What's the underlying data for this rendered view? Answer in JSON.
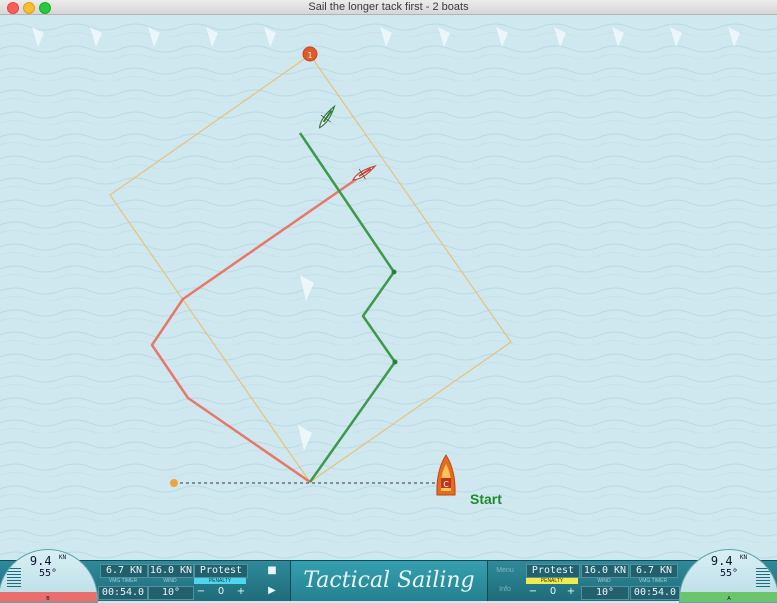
{
  "window": {
    "title": "Sail the longer tack first - 2 boats"
  },
  "course": {
    "mark_label": "1",
    "committee_boat_label": "C",
    "start_label": "Start"
  },
  "colors": {
    "red_boat": "#e8776a",
    "green_boat": "#3c9a4a",
    "laylines": "#e6c27a",
    "sea": "#cfe8f0"
  },
  "left_panel": {
    "speed": "9.4",
    "speed_unit": "KN",
    "heading": "55°",
    "gauge_label": "B",
    "vmg_value": "6.7 KN",
    "vmg_label": "VMG TIMER",
    "wind_value": "16.0 KN",
    "wind_label": "WIND",
    "protest": "Protest",
    "penalty_label": "PENALTY",
    "timer": "00:54.0",
    "wind_shift": "10°",
    "penalty_minus": "−",
    "penalty_value": "0",
    "penalty_plus": "+"
  },
  "controls": {
    "stop_icon": "stop-icon",
    "play_icon": "play-icon"
  },
  "logo_text": "Tactical Sailing",
  "menu": {
    "menu_label": "Menu",
    "info_label": "Info"
  },
  "right_panel": {
    "protest": "Protest",
    "penalty_label": "PENALTY",
    "wind_value": "16.0 KN",
    "wind_label": "WIND",
    "vmg_value": "6.7 KN",
    "vmg_label": "VMG TIMER",
    "penalty_minus": "−",
    "penalty_value": "0",
    "penalty_plus": "+",
    "wind_shift": "10°",
    "timer": "00:54.0",
    "speed": "9.4",
    "speed_unit": "KN",
    "heading": "55°",
    "gauge_label": "A"
  }
}
